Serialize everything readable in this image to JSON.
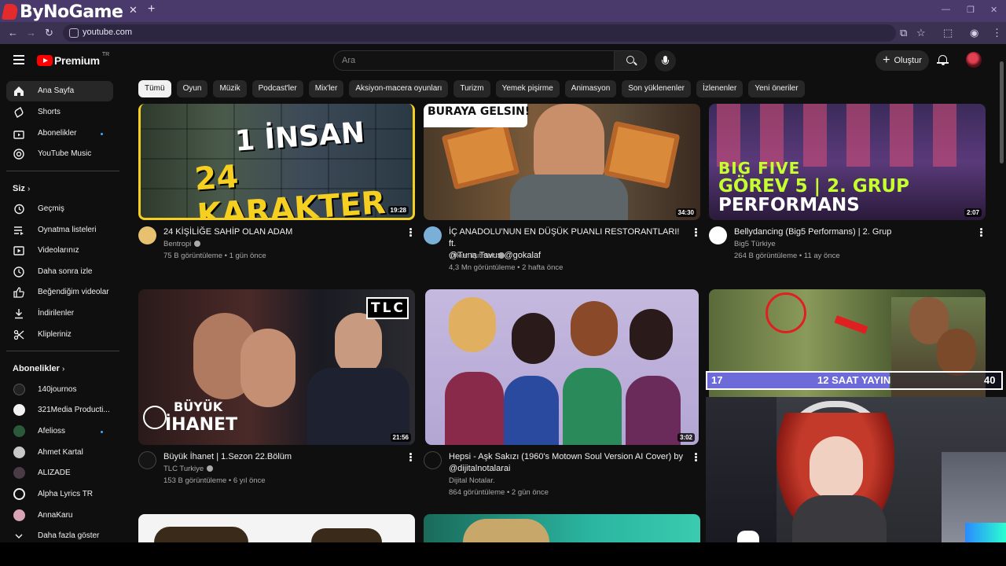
{
  "browser": {
    "watermark": "ByNoGame",
    "url": "youtube.com"
  },
  "yt": {
    "logo_text": "Premium",
    "logo_badge": "TR",
    "search_placeholder": "Ara",
    "create_label": "Oluştur"
  },
  "chips": [
    "Tümü",
    "Oyun",
    "Müzik",
    "Podcast'ler",
    "Mix'ler",
    "Aksiyon-macera oyunları",
    "Turizm",
    "Yemek pişirme",
    "Animasyon",
    "Son yüklenenler",
    "İzlenenler",
    "Yeni öneriler"
  ],
  "sidebar": {
    "main": [
      {
        "label": "Ana Sayfa",
        "icon": "home-icon"
      },
      {
        "label": "Shorts",
        "icon": "shorts-icon"
      },
      {
        "label": "Abonelikler",
        "icon": "subscriptions-icon"
      },
      {
        "label": "YouTube Music",
        "icon": "music-icon"
      }
    ],
    "you_heading": "Siz",
    "you": [
      {
        "label": "Geçmiş",
        "icon": "history-icon"
      },
      {
        "label": "Oynatma listeleri",
        "icon": "playlists-icon"
      },
      {
        "label": "Videolarınız",
        "icon": "your-videos-icon"
      },
      {
        "label": "Daha sonra izle",
        "icon": "watch-later-icon"
      },
      {
        "label": "Beğendiğim videolar",
        "icon": "liked-icon"
      },
      {
        "label": "İndirilenler",
        "icon": "download-icon"
      },
      {
        "label": "Klipleriniz",
        "icon": "clips-icon"
      }
    ],
    "subs_heading": "Abonelikler",
    "subs": [
      {
        "label": "140journos",
        "color": "#222222"
      },
      {
        "label": "321Media Producti...",
        "color": "#f2f2f2"
      },
      {
        "label": "Afelioss",
        "color": "#2b5a3a"
      },
      {
        "label": "Ahmet Kartal",
        "color": "#c8c8c8"
      },
      {
        "label": "ALIZADE",
        "color": "#4a3b44"
      },
      {
        "label": "Alpha Lyrics TR",
        "color": "#f1f1f1"
      },
      {
        "label": "AnnaKaru",
        "color": "#d9a5b6"
      }
    ],
    "show_more": "Daha fazla göster"
  },
  "videos": [
    {
      "title_lines": [
        "24 KİŞİLİĞE SAHİP OLAN ADAM"
      ],
      "channel": "Bentropi",
      "meta": "75 B görüntüleme • 1 gün önce",
      "duration": "19:28",
      "thumb_text": [
        "1 İNSAN",
        "24 KARAKTER"
      ]
    },
    {
      "title_lines": [
        "İÇ ANADOLU'NUN EN DÜŞÜK PUANLI RESTORANTLARI! ft.",
        "@Tuna Tavus  @gokalaf"
      ],
      "channel": "Orkun Işıtmak",
      "meta": "4,3 Mn görüntüleme • 2 hafta önce",
      "duration": "34:30",
      "thumb_text": [
        "BURAYA GELSIN!"
      ]
    },
    {
      "title_lines": [
        "Bellydancing (Big5 Performans) | 2. Grup"
      ],
      "channel": "Big5 Türkiye",
      "meta": "264 B görüntüleme • 11 ay önce",
      "duration": "2:07",
      "thumb_text": [
        "BIG FIVE",
        "GÖREV 5 | 2. GRUP",
        "PERFORMANS"
      ]
    },
    {
      "title_lines": [
        "Büyük İhanet | 1.Sezon 22.Bölüm"
      ],
      "channel": "TLC Turkiye",
      "meta": "153 B görüntüleme • 6 yıl önce",
      "duration": "21:56",
      "thumb_text": [
        "BÜYÜK",
        "İHANET",
        "TLC"
      ]
    },
    {
      "title_lines": [
        "Hepsi - Aşk Sakızı (1960's Motown Soul Version AI Cover) by",
        "@dijitalnotalarai"
      ],
      "channel": "Dijital Notalar.",
      "meta": "864 görüntüleme • 2 gün önce",
      "duration": "3:02",
      "thumb_text": []
    }
  ],
  "overlay": {
    "left": "17",
    "center": "12 SAAT YAYIN",
    "right": "40"
  }
}
